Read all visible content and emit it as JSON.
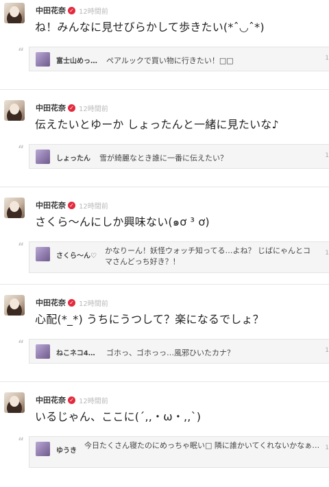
{
  "posts": [
    {
      "author": "中田花奈",
      "time": "12時間前",
      "text": "ね！みんなに見せびらかして歩きたい(*ˆ◡ˆ*)",
      "quote": {
        "name": "富士山めっ…",
        "text": "ペアルックで買い物に行きたい！□□",
        "num": "1"
      }
    },
    {
      "author": "中田花奈",
      "time": "12時間前",
      "text": "伝えたいとゆーか しょったんと一緒に見たいな♪",
      "quote": {
        "name": "しょったん",
        "text": "雪が綺麗なとき誰に一番に伝えたい？",
        "num": "1"
      }
    },
    {
      "author": "中田花奈",
      "time": "12時間前",
      "text": "さくら〜んにしか興味ない(๑ơ ³ ơ)",
      "quote": {
        "name": "さくら〜ん♡",
        "text": "かなりーん！妖怪ウォッチ知ってる…よね？ じばにゃんとコマさんどっち好き？！",
        "num": "1"
      }
    },
    {
      "author": "中田花奈",
      "time": "12時間前",
      "text": "心配(*_*) うちにうつして？楽になるでしょ？",
      "quote": {
        "name": "ねこネコ4…",
        "text": "ゴホっ、ゴホっっ…風邪ひいたカナ？",
        "num": "1"
      }
    },
    {
      "author": "中田花奈",
      "time": "12時間前",
      "text": "いるじゃん、ここに(´,,・ω・,,`)",
      "quote": {
        "name": "ゆうき",
        "text": "今日たくさん寝たのにめっちゃ眠い□ 隣に誰かいてくれないかなぁ…",
        "num": "1"
      }
    }
  ],
  "colors": {
    "verified": "#e32a3e",
    "time": "#b8b8b8",
    "quote_bg": "#f5f5f5"
  },
  "icons": {
    "verified": "check-icon",
    "quote": "quote-icon"
  }
}
